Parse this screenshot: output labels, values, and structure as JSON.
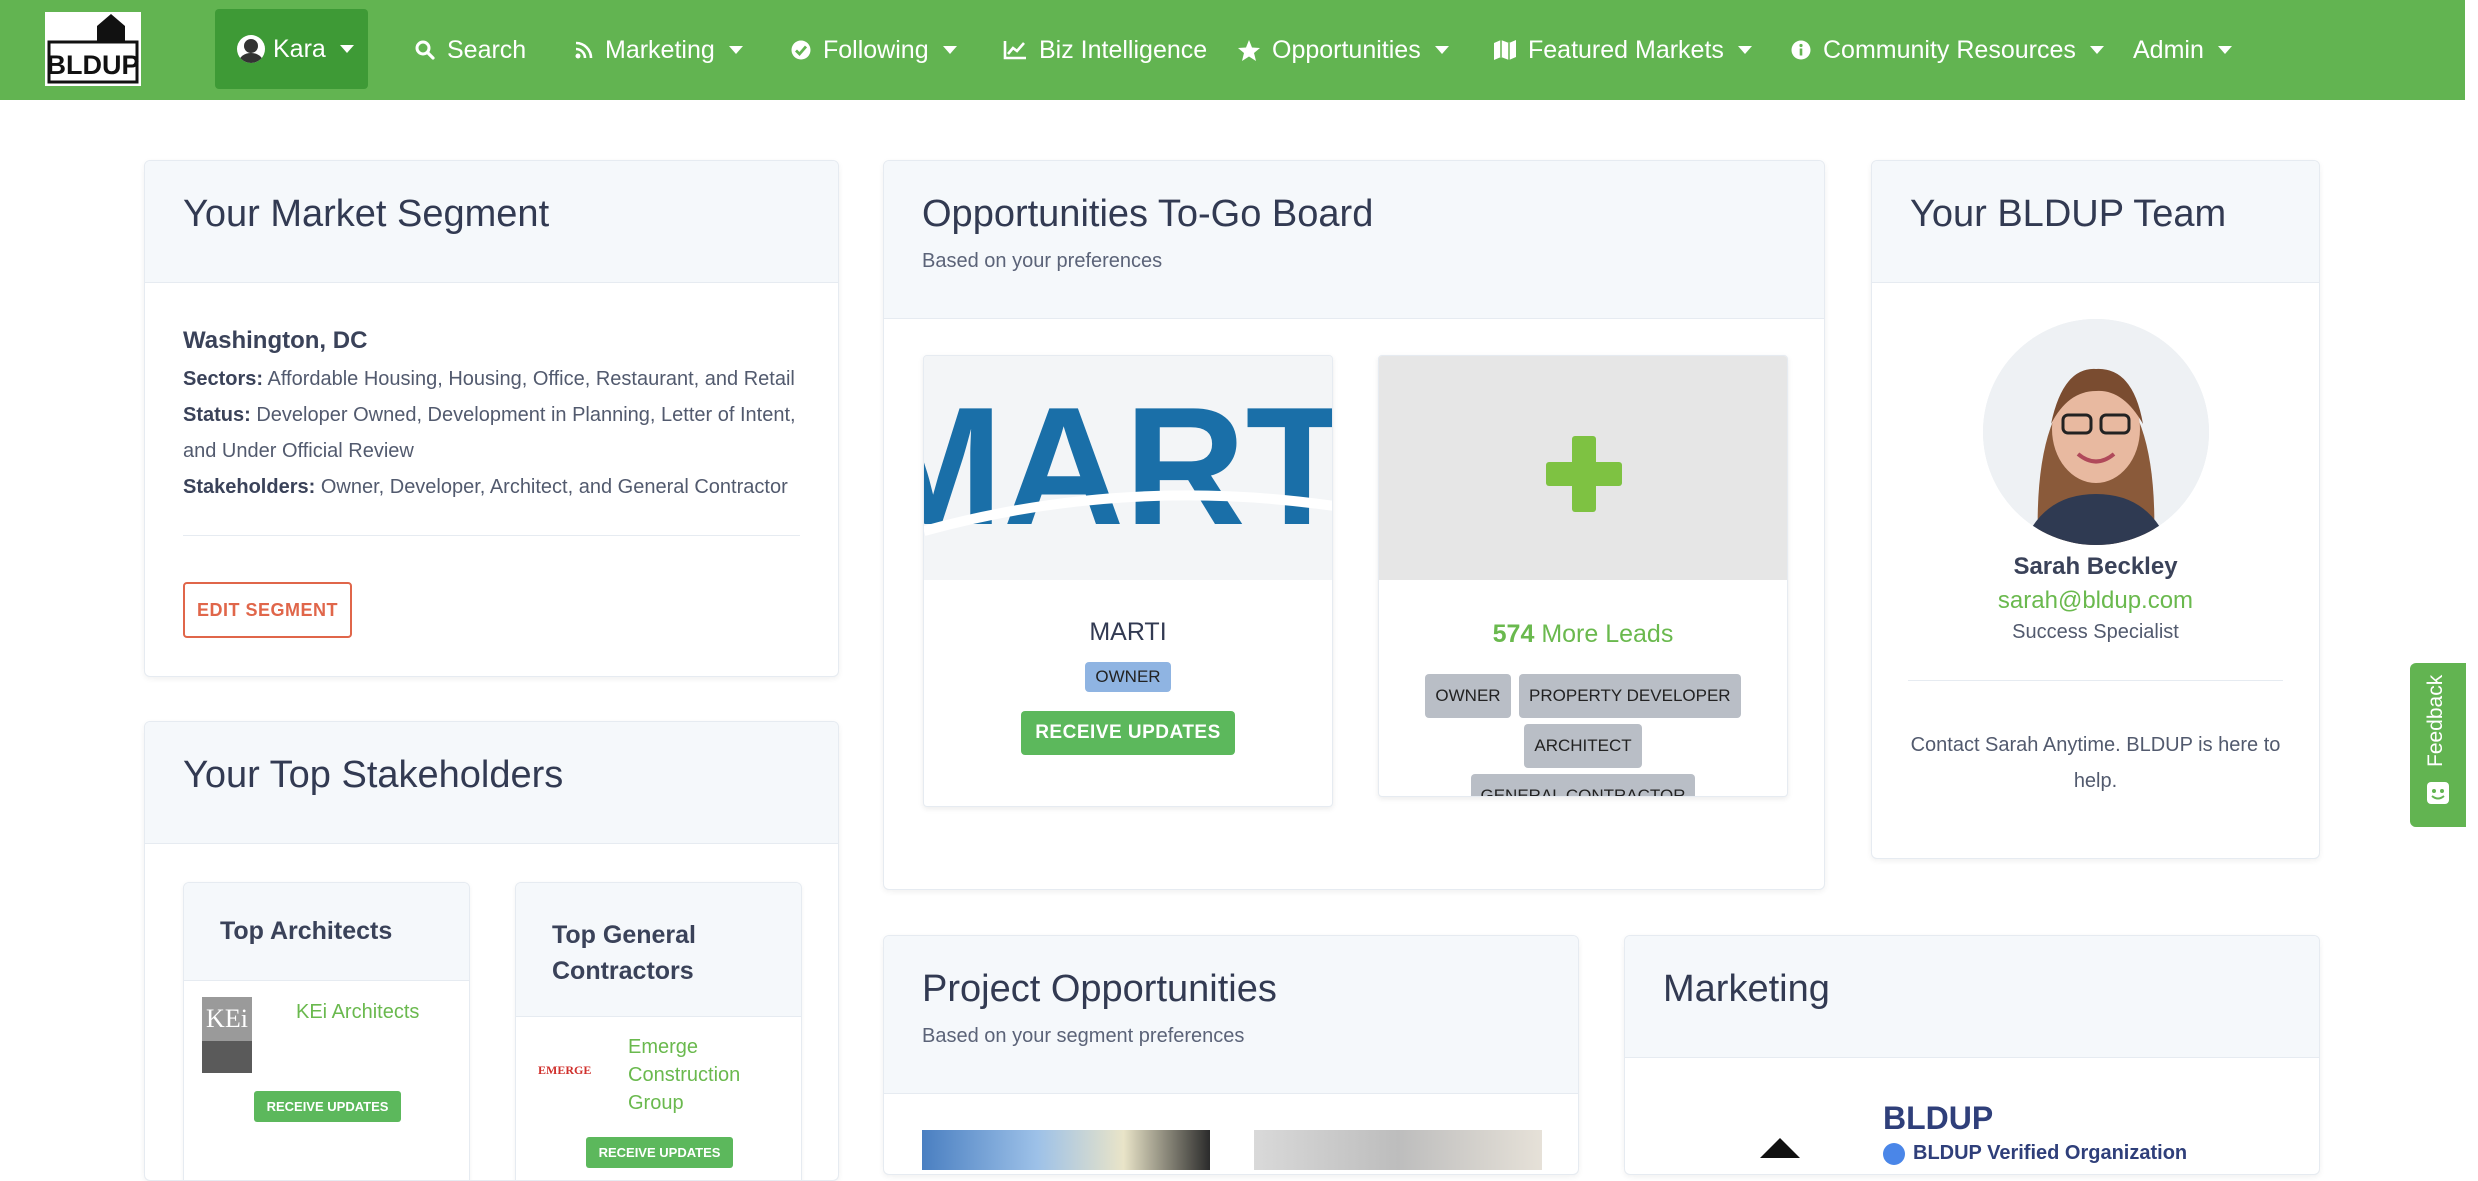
{
  "nav": {
    "logo_text": "BLDUP",
    "user": "Kara",
    "items": [
      {
        "label": "Search",
        "icon": "search-icon"
      },
      {
        "label": "Marketing",
        "icon": "rss-icon"
      },
      {
        "label": "Following",
        "icon": "check-circle-icon"
      },
      {
        "label": "Biz Intelligence",
        "icon": "line-chart-icon"
      },
      {
        "label": "Opportunities",
        "icon": "star-icon"
      },
      {
        "label": "Featured Markets",
        "icon": "map-icon"
      },
      {
        "label": "Community Resources",
        "icon": "info-icon"
      },
      {
        "label": "Admin",
        "icon": ""
      }
    ]
  },
  "market_segment": {
    "title": "Your Market Segment",
    "city": "Washington, DC",
    "sectors_label": "Sectors:",
    "sectors": "Affordable Housing, Housing, Office, Restaurant, and Retail",
    "status_label": "Status:",
    "status": "Developer Owned, Development in Planning, Letter of Intent, and Under Official Review",
    "stakeholders_label": "Stakeholders:",
    "stakeholders": "Owner, Developer, Architect, and General Contractor",
    "edit_button": "EDIT SEGMENT"
  },
  "opportunities_board": {
    "title": "Opportunities To-Go Board",
    "subtitle": "Based on your preferences",
    "lead": {
      "image_text": "MARTI",
      "name": "MARTI",
      "tag": "OWNER",
      "button": "RECEIVE UPDATES"
    },
    "more": {
      "count": "574",
      "label": "More Leads",
      "tags": [
        "OWNER",
        "PROPERTY DEVELOPER",
        "ARCHITECT",
        "GENERAL CONTRACTOR"
      ]
    }
  },
  "team": {
    "title": "Your BLDUP Team",
    "name": "Sarah Beckley",
    "email": "sarah@bldup.com",
    "role": "Success Specialist",
    "message": "Contact Sarah Anytime. BLDUP is here to help."
  },
  "stakeholders": {
    "title": "Your Top Stakeholders",
    "architects": {
      "title": "Top Architects",
      "logo_text": "KEi",
      "name": "KEi Architects",
      "button": "RECEIVE UPDATES"
    },
    "contractors": {
      "title": "Top General Contractors",
      "logo_text": "EMERGE",
      "name": "Emerge Construction Group",
      "button": "RECEIVE UPDATES"
    }
  },
  "project_opportunities": {
    "title": "Project Opportunities",
    "subtitle": "Based on your segment preferences"
  },
  "marketing": {
    "title": "Marketing",
    "org": "BLDUP",
    "verified": "BLDUP Verified Organization"
  },
  "feedback": "Feedback",
  "colors": {
    "brand_green": "#62b451",
    "accent_orange": "#e0664a",
    "tag_blue": "#8fb4e2"
  }
}
